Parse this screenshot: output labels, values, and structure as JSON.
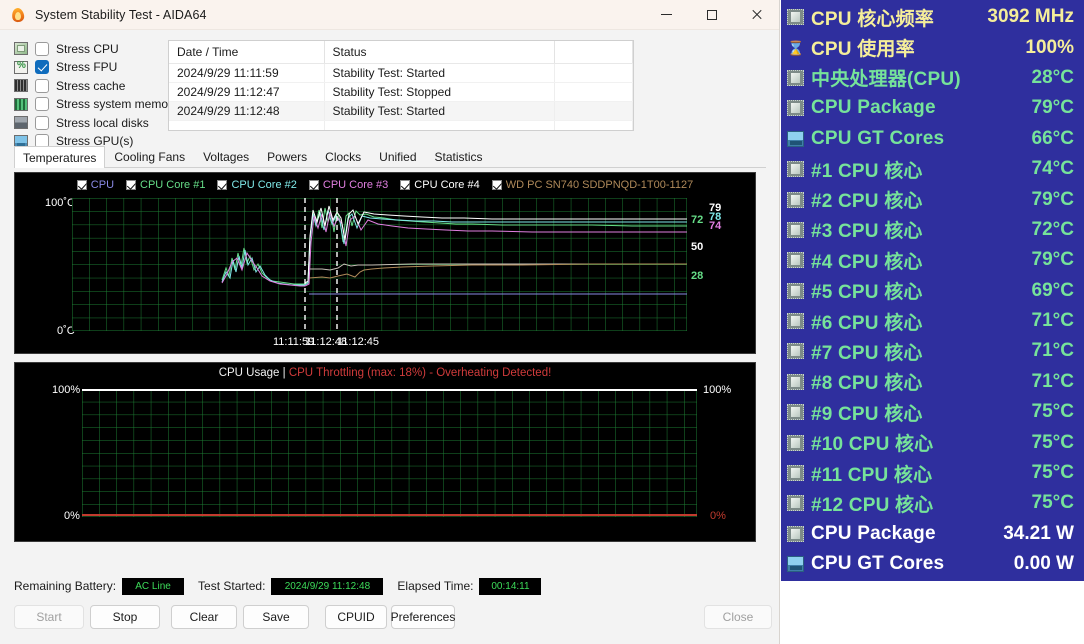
{
  "window": {
    "title": "System Stability Test - AIDA64",
    "app_icon": "flame-icon",
    "minimize_label": "",
    "maximize_label": "",
    "close_label": ""
  },
  "stress_options": [
    {
      "label": "Stress CPU",
      "icon": "cpu-icon",
      "checked": false
    },
    {
      "label": "Stress FPU",
      "icon": "fpu-icon",
      "checked": true
    },
    {
      "label": "Stress cache",
      "icon": "cache-icon",
      "checked": false
    },
    {
      "label": "Stress system memo",
      "icon": "memory-icon",
      "checked": false
    },
    {
      "label": "Stress local disks",
      "icon": "disk-icon",
      "checked": false
    },
    {
      "label": "Stress GPU(s)",
      "icon": "gpu-icon",
      "checked": false
    }
  ],
  "log_table": {
    "columns": [
      "Date / Time",
      "Status",
      ""
    ],
    "rows": [
      {
        "datetime": "2024/9/29 11:11:59",
        "status": "Stability Test: Started"
      },
      {
        "datetime": "2024/9/29 11:12:47",
        "status": "Stability Test: Stopped"
      },
      {
        "datetime": "2024/9/29 11:12:48",
        "status": "Stability Test: Started"
      }
    ]
  },
  "tabs": [
    {
      "label": "Temperatures",
      "active": true
    },
    {
      "label": "Cooling Fans",
      "active": false
    },
    {
      "label": "Voltages",
      "active": false
    },
    {
      "label": "Powers",
      "active": false
    },
    {
      "label": "Clocks",
      "active": false
    },
    {
      "label": "Unified",
      "active": false
    },
    {
      "label": "Statistics",
      "active": false
    }
  ],
  "chart_data": [
    {
      "type": "line",
      "name": "temperature-chart",
      "title": "",
      "ylabel": "",
      "xlabel": "",
      "ylim": [
        0,
        100
      ],
      "y_ticks": [
        "100˚C",
        "0˚C"
      ],
      "x_ticks": [
        "11:11:59",
        "11:12:48",
        "11:12:45"
      ],
      "grid": true,
      "legend_position": "top",
      "right_value_labels": [
        {
          "text": "79",
          "color": "#ffffff"
        },
        {
          "text": "78",
          "color": "#7fe8e8"
        },
        {
          "text": "74",
          "color": "#e07fe0"
        },
        {
          "text": "72",
          "color": "#66dd88"
        },
        {
          "text": "50",
          "color": "#ffffff"
        },
        {
          "text": "28",
          "color": "#66dd88"
        }
      ],
      "series": [
        {
          "name": "CPU",
          "color": "#8a8ae6",
          "last_value": 28
        },
        {
          "name": "CPU Core #1",
          "color": "#66dd88",
          "last_value": 72
        },
        {
          "name": "CPU Core #2",
          "color": "#7fe8e8",
          "last_value": 78
        },
        {
          "name": "CPU Core #3",
          "color": "#e07fe0",
          "last_value": 74
        },
        {
          "name": "CPU Core #4",
          "color": "#ffffff",
          "last_value": 79
        },
        {
          "name": "WD PC SN740 SDDPNQD-1T00-1127",
          "color": "#b08a5a",
          "last_value": 50
        }
      ]
    },
    {
      "type": "line",
      "name": "cpu-usage-chart",
      "title_main": "CPU Usage",
      "title_separator": "|",
      "title_warning": "CPU Throttling (max: 18%) - Overheating Detected!",
      "ylim": [
        0,
        100
      ],
      "y_ticks_left": [
        "100%",
        "0%"
      ],
      "y_ticks_right": [
        "100%",
        "0%"
      ],
      "grid": true,
      "series": [
        {
          "name": "CPU Usage",
          "color": "#ffffff",
          "value": 100
        },
        {
          "name": "CPU Throttling",
          "color": "#c23b2e",
          "value": 0
        }
      ]
    }
  ],
  "status": {
    "battery_label": "Remaining Battery:",
    "battery_value": "AC Line",
    "started_label": "Test Started:",
    "started_value": "2024/9/29 11:12:48",
    "elapsed_label": "Elapsed Time:",
    "elapsed_value": "00:14:11"
  },
  "buttons": [
    {
      "label": "Start",
      "disabled": true
    },
    {
      "label": "Stop",
      "disabled": false
    },
    {
      "label": "Clear",
      "disabled": false
    },
    {
      "label": "Save",
      "disabled": false
    },
    {
      "label": "CPUID",
      "disabled": false
    },
    {
      "label": "Preferences",
      "disabled": false
    },
    {
      "label": "Close",
      "disabled": true
    }
  ],
  "sensor_panel": {
    "background": "#2f2f9e",
    "rows": [
      {
        "icon": "chip-icon",
        "name": "CPU 核心频率",
        "value": "3092 MHz",
        "color": "#f5ee9a"
      },
      {
        "icon": "hourglass-icon",
        "name": "CPU 使用率",
        "value": "100%",
        "color": "#f5ee9a"
      },
      {
        "icon": "chip-icon",
        "name": "中央处理器(CPU)",
        "value": "28°C",
        "color": "#76e39a"
      },
      {
        "icon": "chip-icon",
        "name": "CPU Package",
        "value": "79°C",
        "color": "#76e39a"
      },
      {
        "icon": "gpu-icon",
        "name": "CPU GT Cores",
        "value": "66°C",
        "color": "#76e39a"
      },
      {
        "icon": "chip-icon",
        "name": "#1 CPU 核心",
        "value": "74°C",
        "color": "#76e39a"
      },
      {
        "icon": "chip-icon",
        "name": "#2 CPU 核心",
        "value": "79°C",
        "color": "#76e39a"
      },
      {
        "icon": "chip-icon",
        "name": "#3 CPU 核心",
        "value": "72°C",
        "color": "#76e39a"
      },
      {
        "icon": "chip-icon",
        "name": "#4 CPU 核心",
        "value": "79°C",
        "color": "#76e39a"
      },
      {
        "icon": "chip-icon",
        "name": "#5 CPU 核心",
        "value": "69°C",
        "color": "#76e39a"
      },
      {
        "icon": "chip-icon",
        "name": "#6 CPU 核心",
        "value": "71°C",
        "color": "#76e39a"
      },
      {
        "icon": "chip-icon",
        "name": "#7 CPU 核心",
        "value": "71°C",
        "color": "#76e39a"
      },
      {
        "icon": "chip-icon",
        "name": "#8 CPU 核心",
        "value": "71°C",
        "color": "#76e39a"
      },
      {
        "icon": "chip-icon",
        "name": "#9 CPU 核心",
        "value": "75°C",
        "color": "#76e39a"
      },
      {
        "icon": "chip-icon",
        "name": "#10 CPU 核心",
        "value": "75°C",
        "color": "#76e39a"
      },
      {
        "icon": "chip-icon",
        "name": "#11 CPU 核心",
        "value": "75°C",
        "color": "#76e39a"
      },
      {
        "icon": "chip-icon",
        "name": "#12 CPU 核心",
        "value": "75°C",
        "color": "#76e39a"
      },
      {
        "icon": "chip-icon",
        "name": "CPU Package",
        "value": "34.21 W",
        "color": "#ffffff"
      },
      {
        "icon": "gpu-icon",
        "name": "CPU GT Cores",
        "value": "0.00 W",
        "color": "#ffffff"
      }
    ]
  }
}
